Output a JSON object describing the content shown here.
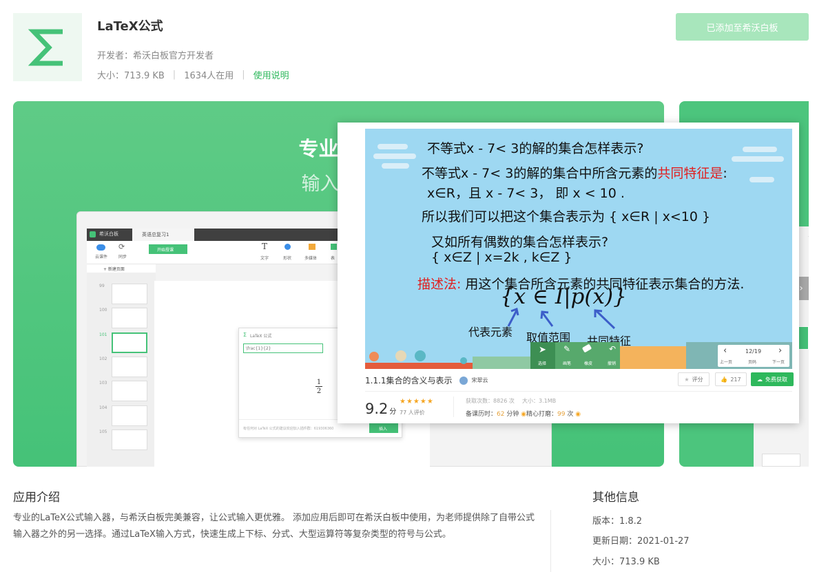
{
  "app": {
    "title": "LaTeX公式",
    "developer": "开发者：希沃白板官方开发者",
    "size": "大小：713.9 KB",
    "users": "1634人在用",
    "help_link": "使用说明",
    "add_button": "已添加至希沃白板",
    "icon": "sigma-icon",
    "accent_color": "#45c278"
  },
  "banner": {
    "headline": "专业的公",
    "subline": "输入代码"
  },
  "laptop": {
    "brand": "希沃白板",
    "doc_tab": "英语总复习1",
    "cloud_label": "云课件",
    "sync_label": "同步",
    "start_button": "开始授课",
    "tool_text": "文字",
    "tool_shape": "形状",
    "tool_media": "多媒体",
    "tool_more": "表",
    "new_page": "+ 新建页面",
    "page_numbers": [
      "99",
      "100",
      "101",
      "102",
      "103",
      "104",
      "105",
      "106"
    ],
    "dialog_title": "LaTeX 公式",
    "dialog_input": "\\frac{1}{2}",
    "dialog_formula_num": "1",
    "dialog_formula_den": "2",
    "dialog_footer": "有任何对 LaTeX 公式的建议欢迎加入插件群：619306360",
    "dialog_insert": "插入"
  },
  "lesson": {
    "line1": "不等式x - 7< 3的解的集合怎样表示?",
    "line2a": "不等式x - 7< 3的解的集合中所含元素的",
    "line2b": "共同特征是",
    "line2c": ":",
    "line3": "x∈R，且 x - 7< 3， 即 x < 10 .",
    "line4": "所以我们可以把这个集合表示为 { x∈R | x<10 }",
    "line5": "又如所有偶数的集合怎样表示?",
    "line6": "{ x∈Z | x=2k , k∈Z      }",
    "line7a": "描述法:",
    "line7b": "用这个集合所含元素的共同特征表示集合的方法.",
    "formula": "{x ∈ I|p(x)}",
    "note1": "代表元素",
    "note2": "取值范围",
    "note3": "共同特征",
    "tool_select": "选择",
    "tool_pen": "画笔",
    "tool_erase": "橡皮",
    "tool_undo": "撤销",
    "page_indicator": "12/19",
    "prev_page": "上一页",
    "page_label": "页码",
    "next_page": "下一页",
    "course_title": "1.1.1集合的含义与表示",
    "teacher": "宋翠云",
    "rate_button": "评分",
    "like_count": "217",
    "get_button": "免费获取",
    "score": "9.2",
    "score_unit": "分",
    "rating_count": "77 人评价",
    "downloads": "获取次数：8826 次",
    "file_size": "大小：3.1MB",
    "prep_time_label": "备课历时：",
    "prep_time_value": "62",
    "prep_time_unit": "分钟",
    "polish_label": "精心打磨：",
    "polish_value": "99",
    "polish_unit": "次"
  },
  "intro": {
    "title": "应用介绍",
    "text": "专业的LaTeX公式输入器，与希沃白板完美兼容，让公式输入更优雅。 添加应用后即可在希沃白板中使用，为老师提供除了自带公式输入器之外的另一选择。通过LaTeX输入方式，快速生成上下标、分式、大型运算符等复杂类型的符号与公式。"
  },
  "other": {
    "title": "其他信息",
    "version": "版本：1.8.2",
    "updated": "更新日期：2021-01-27",
    "size": "大小：713.9 KB"
  }
}
